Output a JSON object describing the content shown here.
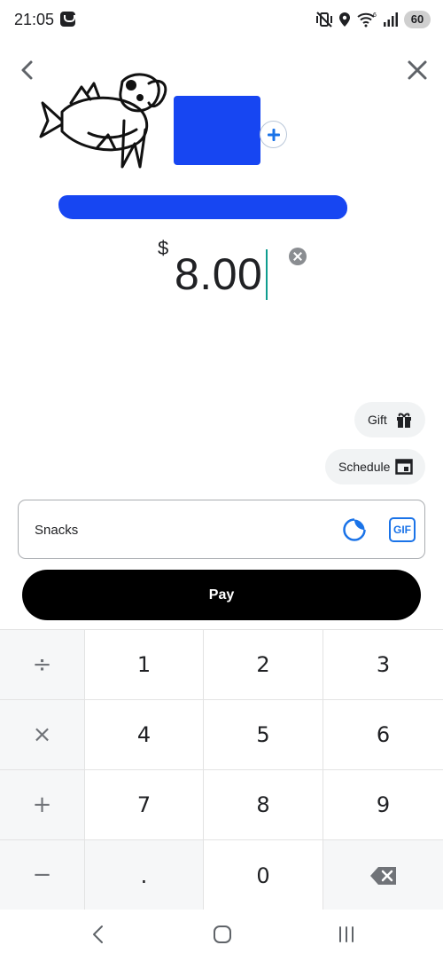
{
  "status_bar": {
    "time": "21:05",
    "battery_level": "60",
    "icons": [
      "messages-app-icon",
      "vibrate-mute-icon",
      "location-icon",
      "wifi-icon",
      "signal-icon",
      "battery-icon"
    ]
  },
  "header": {
    "back_icon": "chevron-left-icon",
    "close_icon": "close-icon"
  },
  "recipient": {
    "add_icon": "plus-circle-icon",
    "name_redacted": true,
    "redaction_color": "#1746f2"
  },
  "amount": {
    "currency_symbol": "$",
    "value": "8.00"
  },
  "chips": {
    "gift_label": "Gift",
    "schedule_label": "Schedule"
  },
  "note": {
    "value": "Snacks",
    "sticker_icon": "sticker-icon",
    "gif_label": "GIF"
  },
  "pay": {
    "label": "Pay"
  },
  "keypad": {
    "operators": [
      "÷",
      "×",
      "+",
      "−"
    ],
    "rows": [
      [
        "1",
        "2",
        "3"
      ],
      [
        "4",
        "5",
        "6"
      ],
      [
        "7",
        "8",
        "9"
      ],
      [
        ".",
        "0",
        "⌫"
      ]
    ]
  },
  "colors": {
    "accent": "#1a73e8",
    "pay_button": "#000000",
    "caret": "#0f9d8f"
  }
}
